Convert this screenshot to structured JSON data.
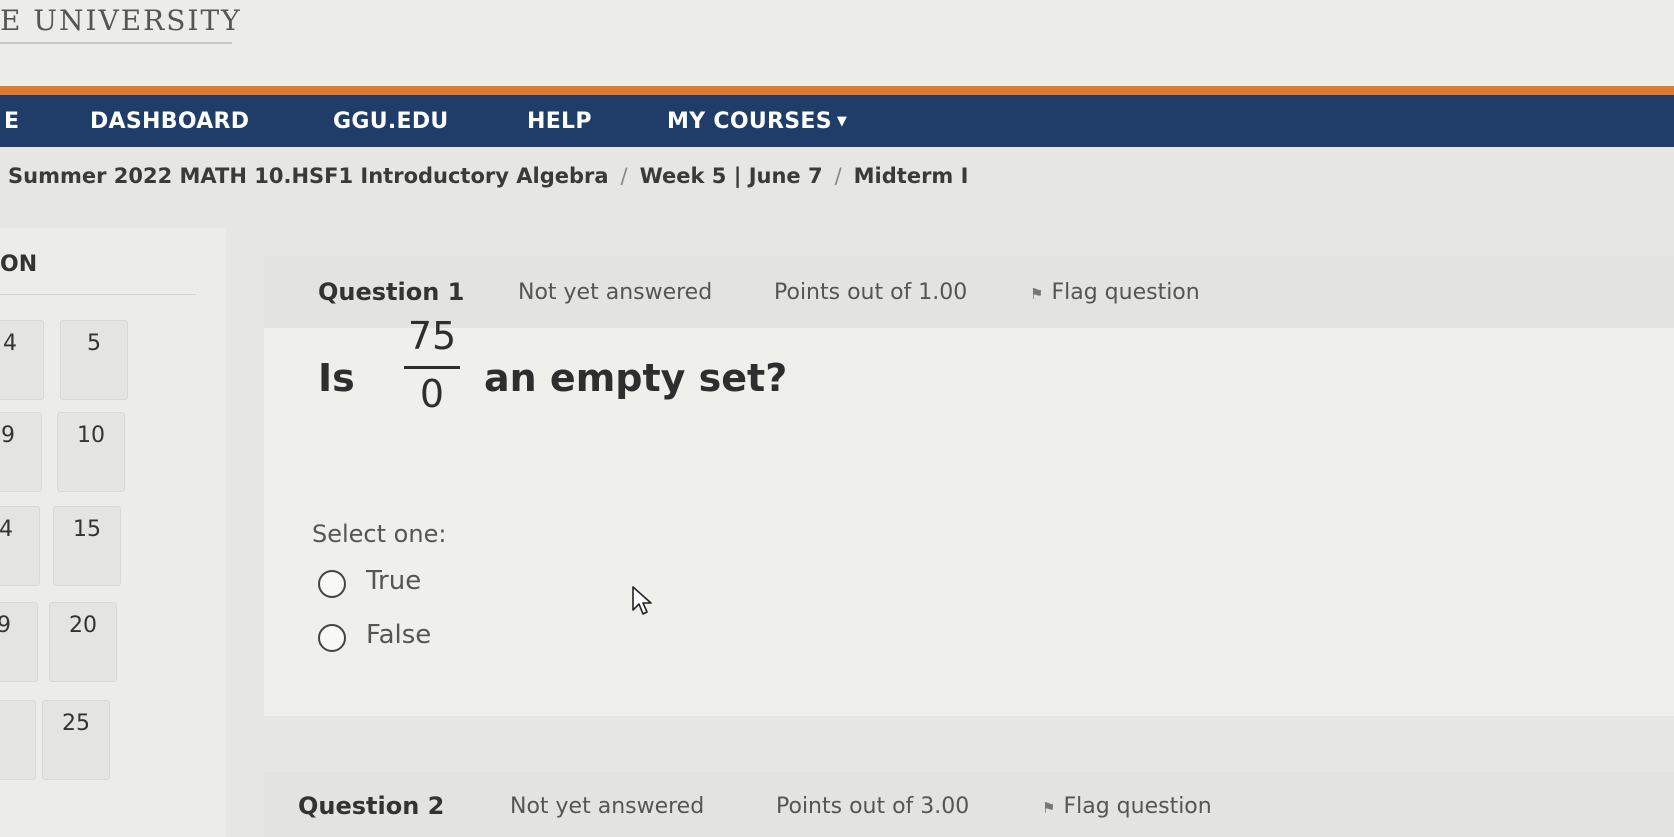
{
  "header": {
    "brand": "E UNIVERSITY"
  },
  "nav": {
    "items": [
      {
        "label": "E"
      },
      {
        "label": "DASHBOARD"
      },
      {
        "label": "GGU.EDU"
      },
      {
        "label": "HELP"
      },
      {
        "label": "MY COURSES"
      }
    ]
  },
  "breadcrumb": {
    "items": [
      "Summer 2022 MATH 10.HSF1 Introductory Algebra",
      "Week 5 | June 7",
      "Midterm I"
    ],
    "separator": "/"
  },
  "quiz_nav": {
    "title": "ON",
    "buttons": [
      "4",
      "5",
      "9",
      "10",
      "4",
      "15",
      "9",
      "20",
      "",
      "25"
    ]
  },
  "questions": [
    {
      "label": "Question 1",
      "state": "Not yet answered",
      "points": "Points out of 1.00",
      "flag": "Flag question",
      "text_before": "Is",
      "fraction": {
        "numerator": "75",
        "denominator": "0"
      },
      "text_after": "an empty set?",
      "prompt": "Select one:",
      "options": [
        "True",
        "False"
      ]
    },
    {
      "label": "Question 2",
      "state": "Not yet answered",
      "points": "Points out of 3.00",
      "flag": "Flag question"
    }
  ],
  "colors": {
    "accent": "#e07a2e",
    "navbar": "#1f3d68"
  }
}
